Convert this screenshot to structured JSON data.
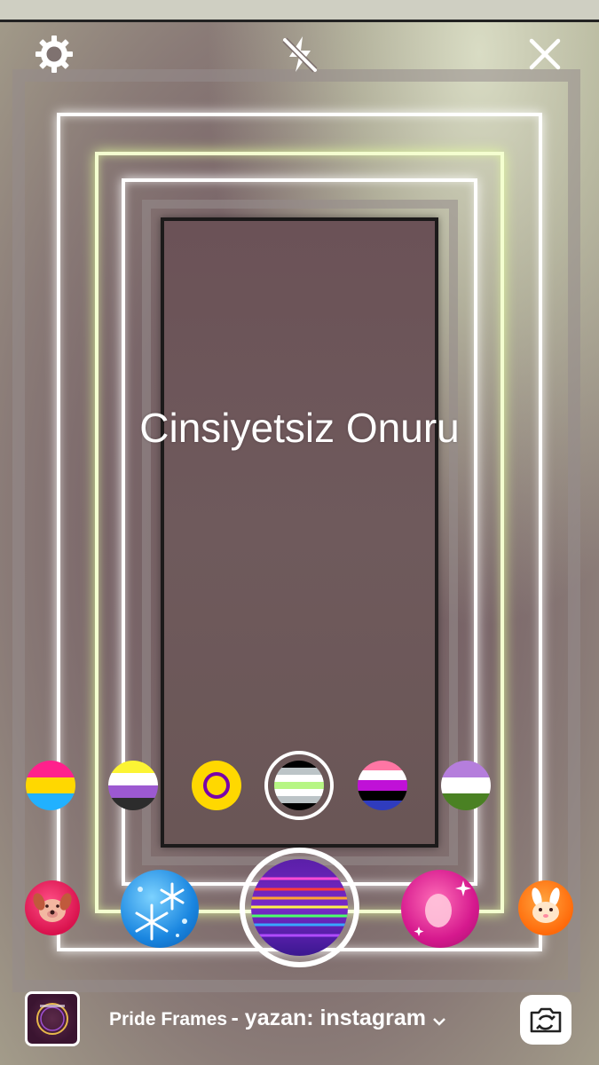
{
  "screen": {
    "overlay_title": "Cinsiyetsiz Onuru"
  },
  "top_controls": {
    "settings_icon": "gear-icon",
    "flash_icon": "flash-off-icon",
    "close_icon": "close-icon"
  },
  "pride_swatches": [
    {
      "name": "pansexual",
      "colors": [
        "#ff218c",
        "#ffd800",
        "#21b1ff"
      ]
    },
    {
      "name": "nonbinary",
      "colors": [
        "#fcf434",
        "#ffffff",
        "#9c59d1",
        "#2c2c2c"
      ]
    },
    {
      "name": "intersex",
      "colors": [
        "#ffd800",
        "#7902aa"
      ]
    },
    {
      "name": "agender",
      "colors": [
        "#000000",
        "#bcc4c7",
        "#ffffff",
        "#b7f684",
        "#ffffff",
        "#bcc4c7",
        "#000000"
      ],
      "selected": true
    },
    {
      "name": "genderfluid",
      "colors": [
        "#ff76a4",
        "#ffffff",
        "#c011d7",
        "#000000",
        "#2f3cbe"
      ]
    },
    {
      "name": "genderqueer",
      "colors": [
        "#b57edc",
        "#ffffff",
        "#4a8123"
      ]
    }
  ],
  "effects": [
    {
      "name": "puppy-effect",
      "icon": "dog-icon"
    },
    {
      "name": "snowflake-effect",
      "icon": "snowflake-icon"
    },
    {
      "name": "pride-frames-effect",
      "icon": "neon-lines-icon",
      "selected": true
    },
    {
      "name": "sparkle-effect",
      "icon": "sparkle-icon"
    },
    {
      "name": "bunny-effect",
      "icon": "bunny-icon"
    }
  ],
  "footer": {
    "effect_name": "Pride Frames",
    "attribution": "- yazan: instagram",
    "chevron_icon": "chevron-down-icon",
    "flip_icon": "camera-flip-icon"
  }
}
